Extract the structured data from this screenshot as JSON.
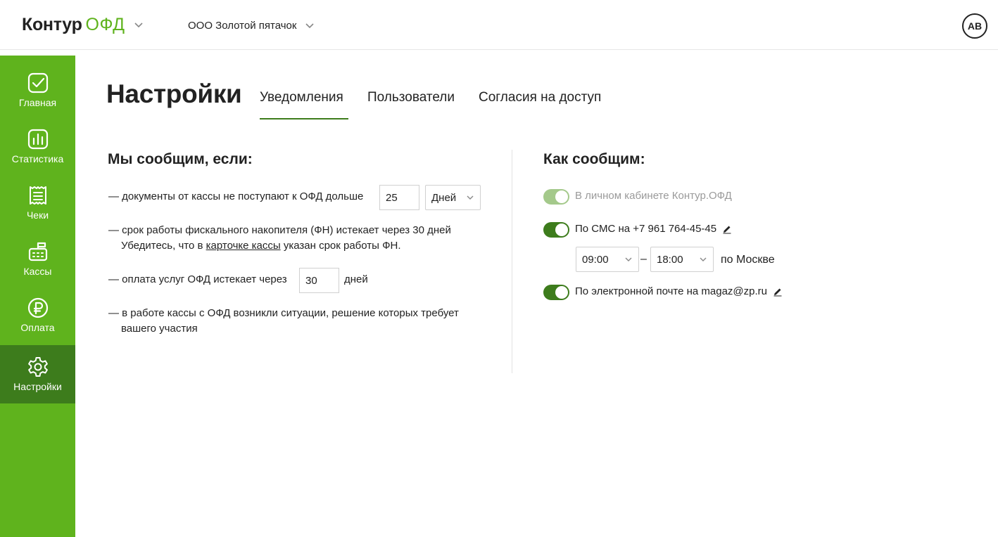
{
  "header": {
    "logo_main": "Контур",
    "logo_product": "ОФД",
    "organization": "ООО Золотой пятачок",
    "avatar_initials": "АВ"
  },
  "sidebar": {
    "items": [
      {
        "label": "Главная",
        "icon": "check-square-icon"
      },
      {
        "label": "Статистика",
        "icon": "bar-chart-icon"
      },
      {
        "label": "Чеки",
        "icon": "receipt-icon"
      },
      {
        "label": "Кассы",
        "icon": "cash-register-icon"
      },
      {
        "label": "Оплата",
        "icon": "ruble-icon"
      },
      {
        "label": "Настройки",
        "icon": "gear-icon",
        "active": true
      }
    ]
  },
  "page": {
    "title": "Настройки",
    "tabs": [
      {
        "label": "Уведомления",
        "active": true
      },
      {
        "label": "Пользователи"
      },
      {
        "label": "Согласия на доступ"
      }
    ]
  },
  "notify_if": {
    "title": "Мы сообщим, если:",
    "rule1": {
      "text": "— документы от кассы не поступают к ОФД дольше",
      "value": "25",
      "unit": "Дней"
    },
    "rule2": {
      "line1": "— срок работы фискального накопителя (ФН) истекает через 30 дней",
      "line2_before": "Убедитесь, что в ",
      "line2_link": "карточке кассы",
      "line2_after": " указан срок работы ФН."
    },
    "rule3": {
      "text": "— оплата услуг ОФД истекает через",
      "value": "30",
      "unit": "дней"
    },
    "rule4": {
      "line1": "— в работе кассы с ОФД возникли ситуации, решение которых требует",
      "line2": "вашего участия"
    }
  },
  "notify_how": {
    "title": "Как сообщим:",
    "cabinet": {
      "label": "В личном кабинете Контур.ОФД",
      "enabled": true,
      "disabled": true
    },
    "sms": {
      "label": "По СМС на +7 961 764-45-45",
      "enabled": true,
      "time_from": "09:00",
      "time_dash": "–",
      "time_to": "18:00",
      "timezone": "по Москве"
    },
    "email": {
      "label": "По электронной почте на magaz@zp.ru",
      "enabled": true
    }
  },
  "colors": {
    "brand_green": "#5fb31d",
    "active_green": "#3d7c1c",
    "disabled_green": "#a4c98b"
  }
}
